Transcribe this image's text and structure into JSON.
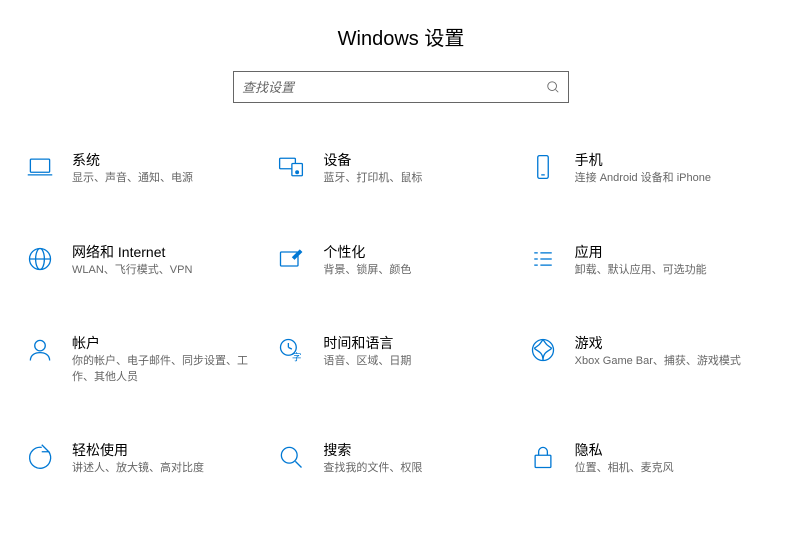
{
  "title": "Windows 设置",
  "search": {
    "placeholder": "查找设置"
  },
  "categories": [
    {
      "id": "system",
      "icon": "laptop-icon",
      "title": "系统",
      "desc": "显示、声音、通知、电源"
    },
    {
      "id": "devices",
      "icon": "devices-icon",
      "title": "设备",
      "desc": "蓝牙、打印机、鼠标"
    },
    {
      "id": "phone",
      "icon": "phone-icon",
      "title": "手机",
      "desc": "连接 Android 设备和 iPhone"
    },
    {
      "id": "network",
      "icon": "globe-icon",
      "title": "网络和 Internet",
      "desc": "WLAN、飞行模式、VPN"
    },
    {
      "id": "personalization",
      "icon": "personalize-icon",
      "title": "个性化",
      "desc": "背景、锁屏、颜色"
    },
    {
      "id": "apps",
      "icon": "apps-icon",
      "title": "应用",
      "desc": "卸载、默认应用、可选功能"
    },
    {
      "id": "accounts",
      "icon": "user-icon",
      "title": "帐户",
      "desc": "你的帐户、电子邮件、同步设置、工作、其他人员"
    },
    {
      "id": "time",
      "icon": "time-lang-icon",
      "title": "时间和语言",
      "desc": "语音、区域、日期"
    },
    {
      "id": "gaming",
      "icon": "gaming-icon",
      "title": "游戏",
      "desc": "Xbox Game Bar、捕获、游戏模式"
    },
    {
      "id": "accessibility",
      "icon": "ease-icon",
      "title": "轻松使用",
      "desc": "讲述人、放大镜、高对比度"
    },
    {
      "id": "search",
      "icon": "search-category-icon",
      "title": "搜索",
      "desc": "查找我的文件、权限"
    },
    {
      "id": "privacy",
      "icon": "lock-icon",
      "title": "隐私",
      "desc": "位置、相机、麦克风"
    }
  ]
}
